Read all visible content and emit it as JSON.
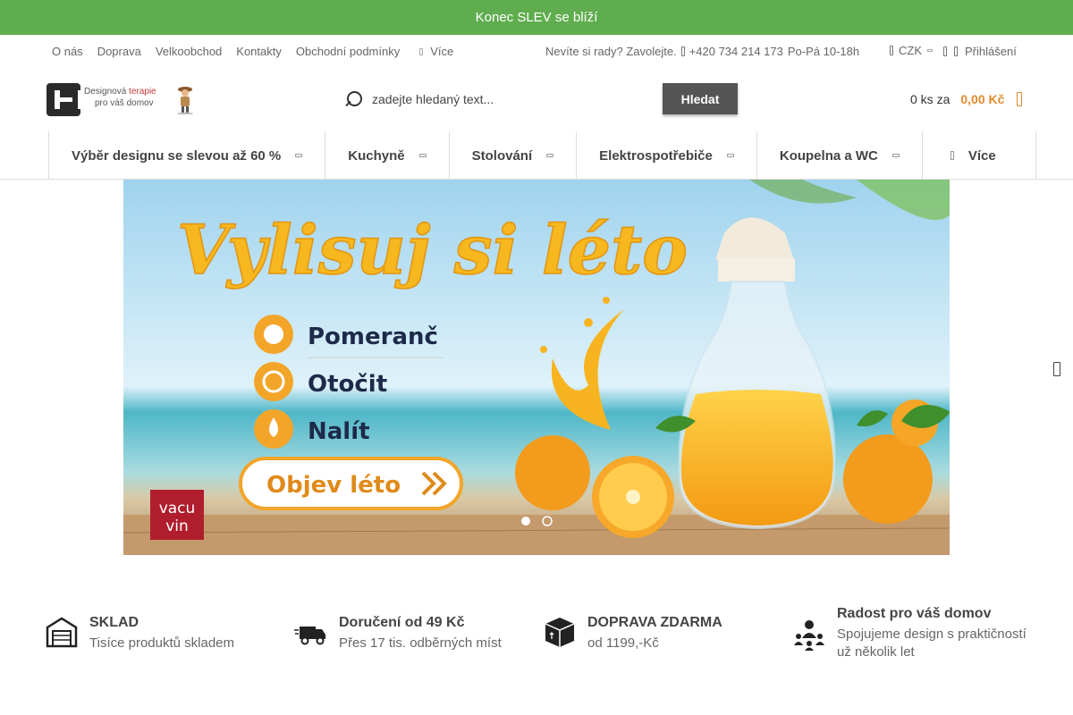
{
  "promo": {
    "text": "Konec SLEV se blíží"
  },
  "topbar": {
    "links": [
      "O nás",
      "Doprava",
      "Velkoobchod",
      "Kontakty",
      "Obchodní podmínky"
    ],
    "more": "Více",
    "help_text": "Nevíte si rady? Zavolejte.",
    "phone": "+420 734 214 173",
    "hours": "Po-Pá 10-18h",
    "currency": "CZK",
    "login": "Přihlášení"
  },
  "header": {
    "logo_line1_a": "Designová",
    "logo_line1_b": "terapie",
    "logo_line2": "pro váš domov",
    "search_placeholder": "zadejte hledaný text...",
    "search_button": "Hledat",
    "cart_count": "0 ks za",
    "cart_price": "0,00 Kč"
  },
  "nav": {
    "items": [
      "Výběr designu se slevou až 60 %",
      "Kuchyně",
      "Stolování",
      "Elektrospotřebiče",
      "Koupelna a WC"
    ],
    "more": "Více"
  },
  "banner": {
    "headline": "Vylisuj si léto",
    "steps": [
      "Pomeranč",
      "Otočit",
      "Nalít"
    ],
    "cta": "Objev léto",
    "brand_line1": "vacu",
    "brand_line2": "vin",
    "slides_total": 2,
    "active_slide": 1
  },
  "features": [
    {
      "icon": "warehouse-icon",
      "title": "SKLAD",
      "sub": "Tisíce produktů skladem"
    },
    {
      "icon": "truck-icon",
      "title": "Doručení od 49 Kč",
      "sub": "Přes 17 tis. odběrných míst"
    },
    {
      "icon": "box-icon",
      "title": "DOPRAVA ZDARMA",
      "sub": "od 1199,-Kč"
    },
    {
      "icon": "people-icon",
      "title": "Radost pro váš domov",
      "sub": "Spojujeme design s praktičností už několik let"
    }
  ],
  "colors": {
    "accent_green": "#5fad4e",
    "price_orange": "#e08a2c",
    "button_dark": "#555555"
  }
}
